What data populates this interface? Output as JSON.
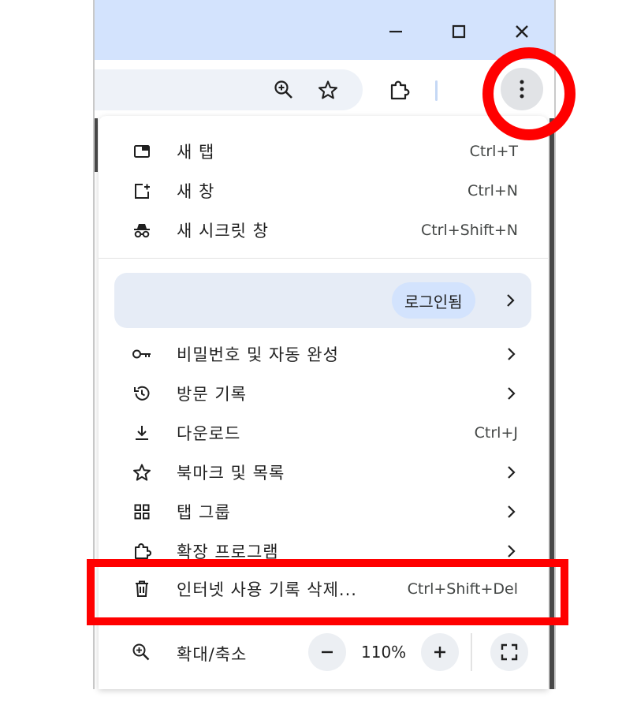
{
  "window": {
    "minimize_glyph": "–",
    "maximize_glyph": "□",
    "close_glyph": "✕"
  },
  "toolbar": {
    "icons": [
      "zoom-in-icon",
      "star-icon",
      "extension-puzzle-icon",
      "more-vert-icon"
    ]
  },
  "menu": {
    "items_top": [
      {
        "label": "새 탭",
        "shortcut": "Ctrl+T",
        "icon": "new-tab-icon"
      },
      {
        "label": "새 창",
        "shortcut": "Ctrl+N",
        "icon": "new-window-icon"
      },
      {
        "label": "새 시크릿 창",
        "shortcut": "Ctrl+Shift+N",
        "icon": "incognito-icon"
      }
    ],
    "profile": {
      "status": "로그인됨"
    },
    "items_bottom": [
      {
        "label": "비밀번호 및 자동 완성",
        "icon": "key-icon",
        "submenu": true
      },
      {
        "label": "방문 기록",
        "icon": "history-icon",
        "submenu": true
      },
      {
        "label": "다운로드",
        "shortcut": "Ctrl+J",
        "icon": "download-icon"
      },
      {
        "label": "북마크 및 목록",
        "icon": "star-icon",
        "submenu": true
      },
      {
        "label": "탭 그룹",
        "icon": "tab-groups-icon",
        "submenu": true
      },
      {
        "label": "확장 프로그램",
        "icon": "extension-puzzle-icon",
        "submenu": true
      },
      {
        "label": "인터넷 사용 기록 삭제...",
        "shortcut": "Ctrl+Shift+Del",
        "icon": "trash-icon"
      }
    ],
    "zoom": {
      "label": "확대/축소",
      "value": "110%",
      "minus": "−",
      "plus": "+"
    }
  },
  "annotations": {
    "highlight_color": "#ff0000"
  }
}
